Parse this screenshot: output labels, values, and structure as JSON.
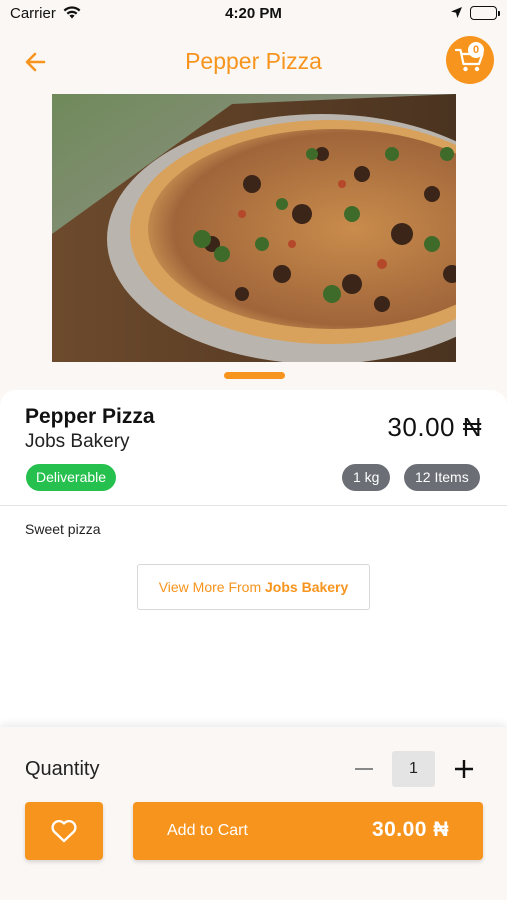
{
  "status_bar": {
    "carrier": "Carrier",
    "time": "4:20 PM"
  },
  "header": {
    "title": "Pepper Pizza",
    "cart_count": "0"
  },
  "product": {
    "name": "Pepper Pizza",
    "shop": "Jobs Bakery",
    "price": "30.00 ₦",
    "delivery_badge": "Deliverable",
    "weight": "1 kg",
    "items": "12 Items",
    "description": "Sweet pizza",
    "view_more_prefix": "View More From ",
    "view_more_shop": "Jobs Bakery"
  },
  "footer": {
    "quantity_label": "Quantity",
    "quantity_value": "1",
    "add_to_cart_label": "Add to Cart",
    "add_to_cart_price": "30.00 ₦"
  },
  "colors": {
    "accent": "#f7941d",
    "deliverable": "#26c04e",
    "tag": "#6b6e75"
  },
  "icons": [
    "wifi-icon",
    "location-icon",
    "battery-icon",
    "back-arrow-icon",
    "cart-icon",
    "minus-icon",
    "plus-icon",
    "heart-icon"
  ]
}
